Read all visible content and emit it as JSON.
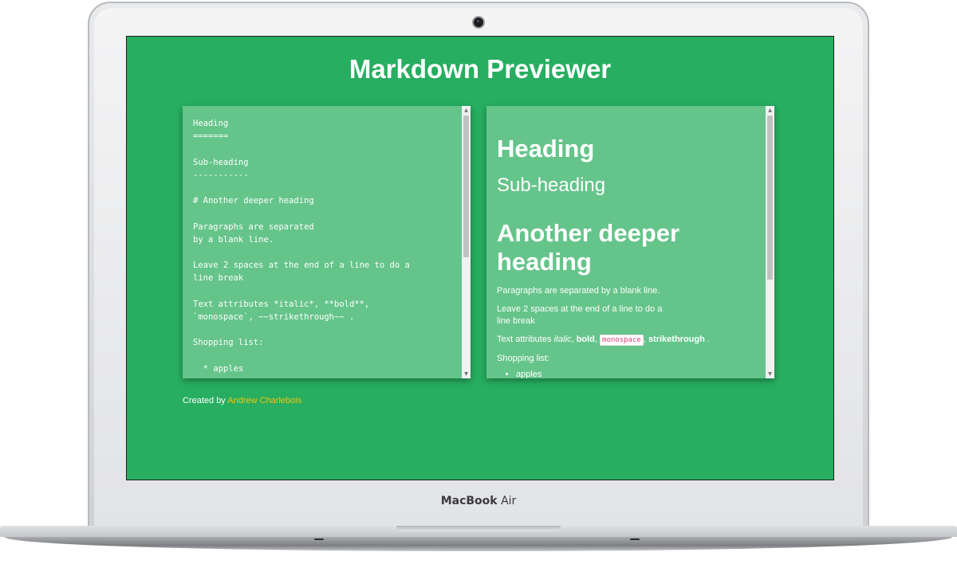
{
  "device": {
    "brand": "MacBook",
    "model": "Air"
  },
  "app": {
    "title": "Markdown Previewer"
  },
  "editor": {
    "lines": [
      "Heading",
      "=======",
      "",
      "Sub-heading",
      "-----------",
      "",
      "# Another deeper heading",
      "",
      "Paragraphs are separated",
      "by a blank line.",
      "",
      "Leave 2 spaces at the end of a line to do a",
      "line break",
      "",
      "Text attributes *italic*, **bold**,",
      "`monospace`, ~~strikethrough~~ .",
      "",
      "Shopping list:",
      "",
      "  * apples"
    ]
  },
  "preview": {
    "h1": "Heading",
    "h2": "Sub-heading",
    "h1_deeper": "Another deeper heading",
    "p1": "Paragraphs are separated by a blank line.",
    "p2_line1": "Leave 2 spaces at the end of a line to do a",
    "p2_line2": "line break",
    "attrs_prefix": "Text attributes ",
    "italic": "italic",
    "sep1": ", ",
    "bold": "bold",
    "sep2": ", ",
    "monospace": "monospace",
    "sep3": ", ",
    "strikethrough": "strikethrough",
    "attrs_suffix": " .",
    "shopping_label": "Shopping list:",
    "list_items": [
      "apples"
    ]
  },
  "footer": {
    "prefix": "Created by ",
    "author": "Andrew Charlebois"
  },
  "colors": {
    "background": "#27ae60",
    "panel": "#65c48a",
    "link": "#f1c40f",
    "code": "#e0407b"
  }
}
